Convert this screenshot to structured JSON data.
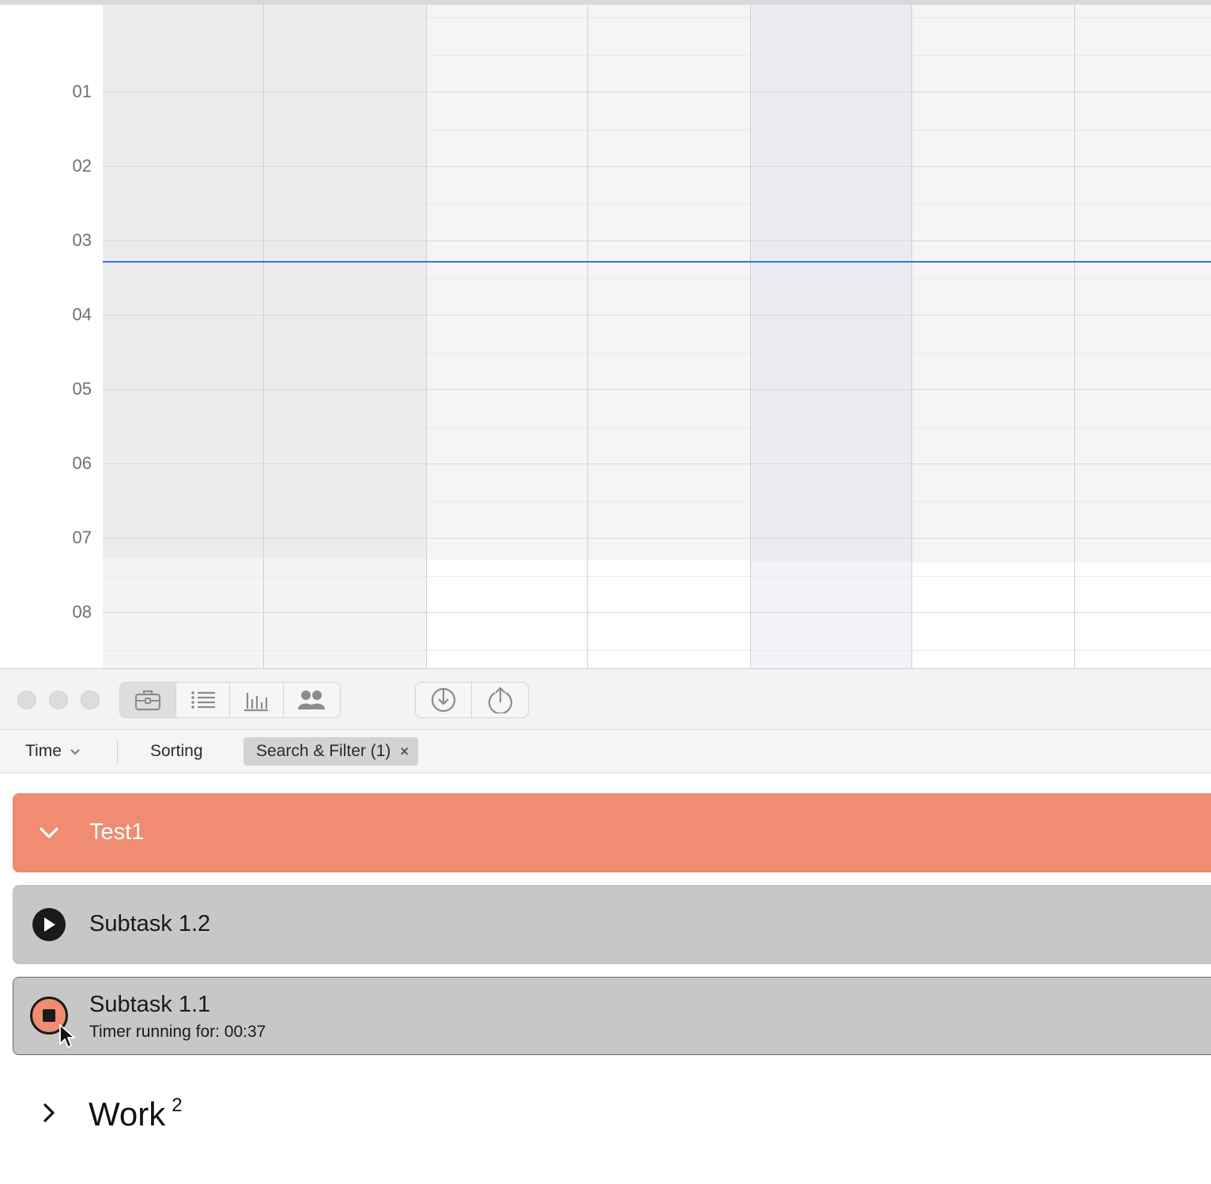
{
  "calendar": {
    "hour_labels": [
      "01",
      "02",
      "03",
      "04",
      "05",
      "06",
      "07",
      "08"
    ]
  },
  "app": {
    "toolbar": {
      "views": [
        {
          "icon": "briefcase-icon",
          "active": true
        },
        {
          "icon": "list-icon",
          "active": false
        },
        {
          "icon": "bar-chart-icon",
          "active": false
        },
        {
          "icon": "people-icon",
          "active": false
        }
      ],
      "actions": [
        {
          "icon": "import-icon"
        },
        {
          "icon": "export-icon"
        }
      ]
    },
    "filterbar": {
      "time_label": "Time",
      "sorting_label": "Sorting",
      "filter_label": "Search & Filter (1)",
      "filter_clear": "×"
    },
    "project": {
      "title": "Test1",
      "color": "#ef8c72"
    },
    "tasks": [
      {
        "title": "Subtask 1.2",
        "state": "stopped"
      },
      {
        "title": "Subtask 1.1",
        "state": "running",
        "status": "Timer running for: 00:37"
      }
    ],
    "group": {
      "title": "Work",
      "count": "2"
    }
  }
}
